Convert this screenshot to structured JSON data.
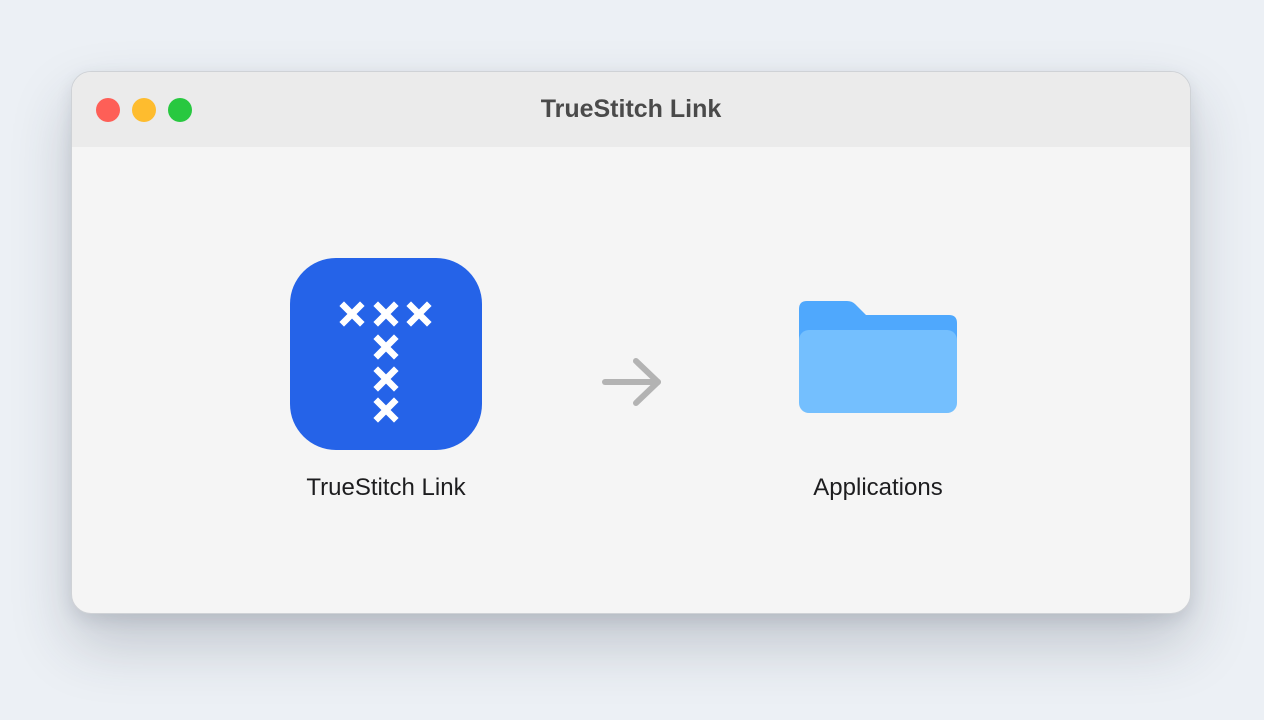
{
  "window": {
    "title": "TrueStitch Link",
    "controls": [
      "close",
      "minimize",
      "zoom"
    ]
  },
  "installer": {
    "app": {
      "label": "TrueStitch Link",
      "icon": "truestitch-app-icon",
      "icon_color": "#2563e8"
    },
    "arrow": {
      "icon": "arrow-right-icon",
      "color": "#b3b3b3"
    },
    "destination": {
      "label": "Applications",
      "icon": "folder-icon",
      "color": "#74bffe",
      "tab_color": "#4fa8fd"
    }
  },
  "colors": {
    "close": "#fe5f57",
    "minimize": "#febc2e",
    "zoom": "#28c840",
    "background": "#ecf0f5"
  }
}
